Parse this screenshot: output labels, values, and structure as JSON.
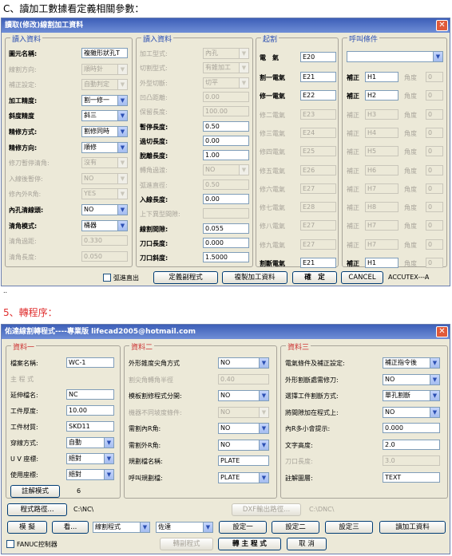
{
  "section_c": {
    "prefix": "C、",
    "text": "讀加工數據看定義相關參數："
  },
  "dialog1": {
    "title": "讀取(修改)線割加工資料",
    "input_group_1": {
      "title": "讀入資料",
      "rows": [
        {
          "label": "圖元名稱:",
          "value": "複雜形狀孔T",
          "type": "field",
          "enabled": true
        },
        {
          "label": "線割方向:",
          "value": "順時針",
          "type": "select",
          "enabled": false
        },
        {
          "label": "補正設定:",
          "value": "自動判定",
          "type": "select",
          "enabled": false
        },
        {
          "label": "加工精度:",
          "value": "割一修一",
          "type": "select",
          "enabled": true
        },
        {
          "label": "斜度精度",
          "value": "斜三",
          "type": "select",
          "enabled": true
        },
        {
          "label": "精修方式:",
          "value": "割修同時",
          "type": "select",
          "enabled": true
        },
        {
          "label": "精修方向:",
          "value": "順修",
          "type": "select",
          "enabled": true
        },
        {
          "label": "修刀暫停清角:",
          "value": "沒有",
          "type": "select",
          "enabled": false
        },
        {
          "label": "入線後暫停:",
          "value": "NO",
          "type": "select",
          "enabled": false
        },
        {
          "label": "修內外R角:",
          "value": "YES",
          "type": "select",
          "enabled": false
        },
        {
          "label": "內孔清線頭:",
          "value": "NO",
          "type": "select",
          "enabled": true
        },
        {
          "label": "清角模式:",
          "value": "桶器",
          "type": "select",
          "enabled": true
        },
        {
          "label": "清角過距:",
          "value": "0.330",
          "type": "field",
          "enabled": false
        },
        {
          "label": "清角長度:",
          "value": "0.050",
          "type": "field",
          "enabled": false
        }
      ]
    },
    "input_group_2": {
      "title": "讀入資料",
      "rows": [
        {
          "label": "加工型式:",
          "value": "內孔",
          "type": "select",
          "enabled": false
        },
        {
          "label": "切割型式:",
          "value": "有錐加工",
          "type": "select",
          "enabled": false
        },
        {
          "label": "外型切斷:",
          "value": "切平",
          "type": "select",
          "enabled": false
        },
        {
          "label": "凹凸距離:",
          "value": "0.00",
          "type": "field",
          "enabled": false
        },
        {
          "label": "保留長度:",
          "value": "100.00",
          "type": "field",
          "enabled": false
        },
        {
          "label": "暫停長度:",
          "value": "0.50",
          "type": "field",
          "enabled": true
        },
        {
          "label": "過切長度:",
          "value": "0.00",
          "type": "field",
          "enabled": true
        },
        {
          "label": "脫離長度:",
          "value": "1.00",
          "type": "field",
          "enabled": true
        },
        {
          "label": "轉角過渡:",
          "value": "NO",
          "type": "select",
          "enabled": false
        },
        {
          "label": "弧進直徑:",
          "value": "0.50",
          "type": "field",
          "enabled": false
        },
        {
          "label": "入線長度:",
          "value": "0.00",
          "type": "field",
          "enabled": true
        },
        {
          "label": "上下異型間隙:",
          "value": "",
          "type": "field",
          "enabled": false
        },
        {
          "label": "線割間隙:",
          "value": "0.055",
          "type": "field",
          "enabled": true
        },
        {
          "label": "刀口長度:",
          "value": "0.000",
          "type": "field",
          "enabled": true
        },
        {
          "label": "刀口斜度:",
          "value": "1.5000",
          "type": "field",
          "enabled": true
        }
      ]
    },
    "start_group": {
      "title": "起割",
      "electric_label": "電　氣",
      "electric_value": "E20",
      "comp_label": "補正",
      "angle_label": "角度",
      "rows": [
        {
          "label": "割一電氣",
          "e": "E21",
          "h": "H1",
          "a": "0",
          "enabled": true
        },
        {
          "label": "修一電氣",
          "e": "E22",
          "h": "H2",
          "a": "0",
          "enabled": true
        },
        {
          "label": "修二電氣",
          "e": "E23",
          "h": "H3",
          "a": "0",
          "enabled": false
        },
        {
          "label": "修三電氣",
          "e": "E24",
          "h": "H4",
          "a": "0",
          "enabled": false
        },
        {
          "label": "修四電氣",
          "e": "E25",
          "h": "H5",
          "a": "0",
          "enabled": false
        },
        {
          "label": "修五電氣",
          "e": "E26",
          "h": "H6",
          "a": "0",
          "enabled": false
        },
        {
          "label": "修六電氣",
          "e": "E27",
          "h": "H7",
          "a": "0",
          "enabled": false
        },
        {
          "label": "修七電氣",
          "e": "E28",
          "h": "H8",
          "a": "0",
          "enabled": false
        },
        {
          "label": "修八電氣",
          "e": "E27",
          "h": "H7",
          "a": "0",
          "enabled": false
        },
        {
          "label": "修九電氣",
          "e": "E27",
          "h": "H7",
          "a": "0",
          "enabled": false
        },
        {
          "label": "割斷電氣",
          "e": "E21",
          "h": "H1",
          "a": "0",
          "enabled": true
        }
      ]
    },
    "call_group": {
      "title": "呼叫條件",
      "value": ""
    },
    "footer": {
      "arc_exit": "弧進直出",
      "define_sub": "定義副程式",
      "copy_data": "複製加工資料",
      "ok": "確　定",
      "cancel": "CANCEL",
      "brand": "ACCUTEX---A"
    }
  },
  "dots": "..",
  "section_5": {
    "prefix": "5、",
    "text": "轉程序："
  },
  "dialog2": {
    "title": "佑達線割轉程式----專業版  lifecad2005@hotmail.com",
    "g1": {
      "title": "資料一",
      "file_label": "檔案名稱:",
      "file_value": "WC-1",
      "main_label": "主 程 式",
      "ext_label": "延伸檔名:",
      "ext_value": "NC",
      "thick_label": "工件厚度:",
      "thick_value": "10.00",
      "mat_label": "工件材質:",
      "mat_value": "SKD11",
      "thread_label": "穿線方式:",
      "thread_value": "自動",
      "uv_label": "U V 座標:",
      "uv_value": "絕對",
      "use_label": "使用座標:",
      "use_value": "絕對",
      "comment_btn": "註解模式",
      "comment_num": "6"
    },
    "g2": {
      "title": "資料二",
      "rows": [
        {
          "label": "外形錐度尖角方式",
          "value": "NO",
          "type": "select",
          "enabled": true
        },
        {
          "label": "割尖角轉角半徑",
          "value": "0.40",
          "type": "field",
          "enabled": false
        },
        {
          "label": "模板割修程式分開:",
          "value": "NO",
          "type": "select",
          "enabled": true
        },
        {
          "label": "機器不同坡度條件:",
          "value": "NO",
          "type": "select",
          "enabled": false
        },
        {
          "label": "需割內R角:",
          "value": "NO",
          "type": "select",
          "enabled": true
        },
        {
          "label": "需割外R角:",
          "value": "NO",
          "type": "select",
          "enabled": true
        },
        {
          "label": "規劃檔名稱:",
          "value": "PLATE",
          "type": "field",
          "enabled": true
        },
        {
          "label": "呼叫規劃檔:",
          "value": "PLATE",
          "type": "select",
          "enabled": true
        }
      ]
    },
    "g3": {
      "title": "資料三",
      "rows": [
        {
          "label": "電氣條件及補正設定:",
          "value": "補正指令後",
          "type": "select",
          "enabled": true
        },
        {
          "label": "外形割斷處需修刀:",
          "value": "NO",
          "type": "select",
          "enabled": true
        },
        {
          "label": "選擇工件割斷方式:",
          "value": "單孔割斷",
          "type": "select",
          "enabled": true
        },
        {
          "label": "將間隙加在程式上:",
          "value": "NO",
          "type": "select",
          "enabled": true
        },
        {
          "label": "內R多小會提示:",
          "value": "0.000",
          "type": "field",
          "enabled": true
        },
        {
          "label": "文字高度:",
          "value": "2.0",
          "type": "field",
          "enabled": true
        },
        {
          "label": "刀口長度:",
          "value": "3.0",
          "type": "field",
          "enabled": false
        },
        {
          "label": "註解圖層:",
          "value": "TEXT",
          "type": "field",
          "enabled": true
        }
      ]
    },
    "path_btn": "程式路徑...",
    "path_value": "C:\\NC\\",
    "dxf_btn": "DXF輸出路徑...",
    "dxf_value": "C:\\DNC\\",
    "simulate_btn": "模 擬",
    "view_btn": "看...",
    "program_select": "線割程式",
    "type_select": "佐達",
    "set1": "設定一",
    "set2": "設定二",
    "set3": "設定三",
    "read_data": "讀加工資料",
    "fanuc": "FANUC控制器",
    "sub_program": "轉副程式",
    "main_program": "轉 主 程 式",
    "cancel": "取 消"
  }
}
